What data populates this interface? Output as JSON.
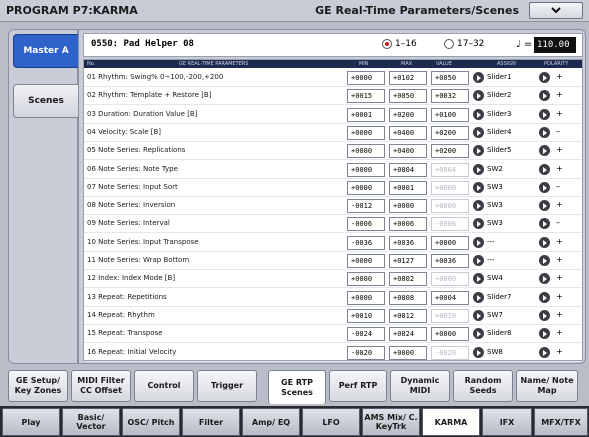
{
  "title": {
    "left": "PROGRAM P7:KARMA",
    "right": "GE Real-Time Parameters/Scenes"
  },
  "left_tabs": [
    {
      "label": "Master A",
      "active": true
    },
    {
      "label": "Scenes",
      "active": false
    }
  ],
  "header": {
    "program": "0550: Pad Helper 08",
    "range1": "1–16",
    "range2": "17–32",
    "tempo_symbol": "♩ =",
    "tempo": "110.00"
  },
  "table": {
    "columns": {
      "no": "No.",
      "name": "GE REAL-TIME PARAMETERS",
      "min": "MIN",
      "max": "MAX",
      "value": "VALUE",
      "assign": "ASSIGN",
      "polarity": "POLARITY"
    },
    "rows": [
      {
        "label": "01  Rhythm: Swing% 0~100,-200,+200",
        "min": "+0000",
        "max": "+0102",
        "value": "+0050",
        "dim": false,
        "assign": "Slider1",
        "pol": "+"
      },
      {
        "label": "02  Rhythm: Template + Restore [B]",
        "min": "+0015",
        "max": "+0050",
        "value": "+0032",
        "dim": false,
        "assign": "Slider2",
        "pol": "+"
      },
      {
        "label": "03  Duration: Duration Value [B]",
        "min": "+0001",
        "max": "+0200",
        "value": "+0100",
        "dim": false,
        "assign": "Slider3",
        "pol": "+"
      },
      {
        "label": "04  Velocity: Scale [B]",
        "min": "+0000",
        "max": "+0400",
        "value": "+0200",
        "dim": false,
        "assign": "Slider4",
        "pol": "–"
      },
      {
        "label": "05  Note Series: Replications",
        "min": "+0000",
        "max": "+0400",
        "value": "+0200",
        "dim": false,
        "assign": "Slider5",
        "pol": "+"
      },
      {
        "label": "06  Note Series: Note Type",
        "min": "+0000",
        "max": "+0004",
        "value": "+0004",
        "dim": true,
        "assign": "SW2",
        "pol": "+"
      },
      {
        "label": "07  Note Series: Input Sort",
        "min": "+0000",
        "max": "+0001",
        "value": "+0000",
        "dim": true,
        "assign": "SW3",
        "pol": "–"
      },
      {
        "label": "08  Note Series: Inversion",
        "min": "-0012",
        "max": "+0000",
        "value": "+0000",
        "dim": true,
        "assign": "SW3",
        "pol": "+"
      },
      {
        "label": "09  Note Series: Interval",
        "min": "-0006",
        "max": "+0006",
        "value": "-0006",
        "dim": true,
        "assign": "SW3",
        "pol": "–"
      },
      {
        "label": "10  Note Series: Input Transpose",
        "min": "-0036",
        "max": "+0036",
        "value": "+0000",
        "dim": false,
        "assign": "---",
        "pol": "+"
      },
      {
        "label": "11  Note Series: Wrap Bottom",
        "min": "+0000",
        "max": "+0127",
        "value": "+0036",
        "dim": false,
        "assign": "---",
        "pol": "+"
      },
      {
        "label": "12  Index: Index Mode [B]",
        "min": "+0000",
        "max": "+0002",
        "value": "+0000",
        "dim": true,
        "assign": "SW4",
        "pol": "+"
      },
      {
        "label": "13  Repeat: Repetitions",
        "min": "+0000",
        "max": "+0008",
        "value": "+0004",
        "dim": false,
        "assign": "Slider7",
        "pol": "+"
      },
      {
        "label": "14  Repeat: Rhythm",
        "min": "+0010",
        "max": "+0012",
        "value": "+0010",
        "dim": true,
        "assign": "SW7",
        "pol": "+"
      },
      {
        "label": "15  Repeat: Transpose",
        "min": "-0024",
        "max": "+0024",
        "value": "+0000",
        "dim": false,
        "assign": "Slider8",
        "pol": "+"
      },
      {
        "label": "16  Repeat: Initial Velocity",
        "min": "-0020",
        "max": "+0000",
        "value": "-0020",
        "dim": true,
        "assign": "SW8",
        "pol": "+"
      }
    ]
  },
  "sub_tabs": [
    {
      "label": "GE Setup/ Key Zones",
      "active": false
    },
    {
      "label": "MIDI Filter CC Offset",
      "active": false
    },
    {
      "label": "Control",
      "active": false
    },
    {
      "label": "Trigger",
      "active": false
    },
    {
      "label": "GE RTP Scenes",
      "active": true
    },
    {
      "label": "Perf RTP",
      "active": false
    },
    {
      "label": "Dynamic MIDI",
      "active": false
    },
    {
      "label": "Random Seeds",
      "active": false
    },
    {
      "label": "Name/ Note Map",
      "active": false
    }
  ],
  "main_tabs": [
    {
      "label": "Play",
      "active": false
    },
    {
      "label": "Basic/ Vector",
      "active": false
    },
    {
      "label": "OSC/ Pitch",
      "active": false
    },
    {
      "label": "Filter",
      "active": false
    },
    {
      "label": "Amp/ EQ",
      "active": false
    },
    {
      "label": "LFO",
      "active": false
    },
    {
      "label": "AMS Mix/ C. KeyTrk",
      "active": false
    },
    {
      "label": "KARMA",
      "active": true
    },
    {
      "label": "IFX",
      "active": false
    },
    {
      "label": "MFX/TFX",
      "active": false
    }
  ]
}
